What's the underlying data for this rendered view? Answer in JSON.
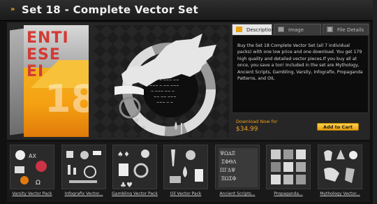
{
  "title": {
    "text": "Set 18 - Complete Vector Set"
  },
  "product_box": {
    "word_lines": [
      "ENTI",
      "ESE",
      "EI"
    ],
    "number": "18"
  },
  "tabs": [
    {
      "label": "Description",
      "icon": "document-icon",
      "active": true
    },
    {
      "label": "Image Gallery",
      "icon": "image-icon",
      "active": false
    },
    {
      "label": "File Details",
      "icon": "file-icon",
      "active": false
    }
  ],
  "description": "Buy the Set 18 Complete Vector Set (all 7 individual packs) with one low price and one download. You get 179 high quality and detailed vector pieces.If you buy all at once, you save a ton! Included in the set are Mythology, Ancient Scripts, Gambling, Varsity, Infografix, Propaganda Patterns, and OIL",
  "purchase": {
    "download_label": "Download Now for",
    "price": "$34.99",
    "cart_button": "Add to Cart"
  },
  "packs": [
    {
      "name": "Varsity Vector Pack"
    },
    {
      "name": "Infografix Vector..."
    },
    {
      "name": "Gambling Vector Pack"
    },
    {
      "name": "Oil Vector Pack"
    },
    {
      "name": "Ancient Scripts..."
    },
    {
      "name": "Propaganda..."
    },
    {
      "name": "Mythology Vector..."
    }
  ],
  "colors": {
    "accent": "#f0a020",
    "button": "#ffd34d",
    "background": "#111111"
  }
}
